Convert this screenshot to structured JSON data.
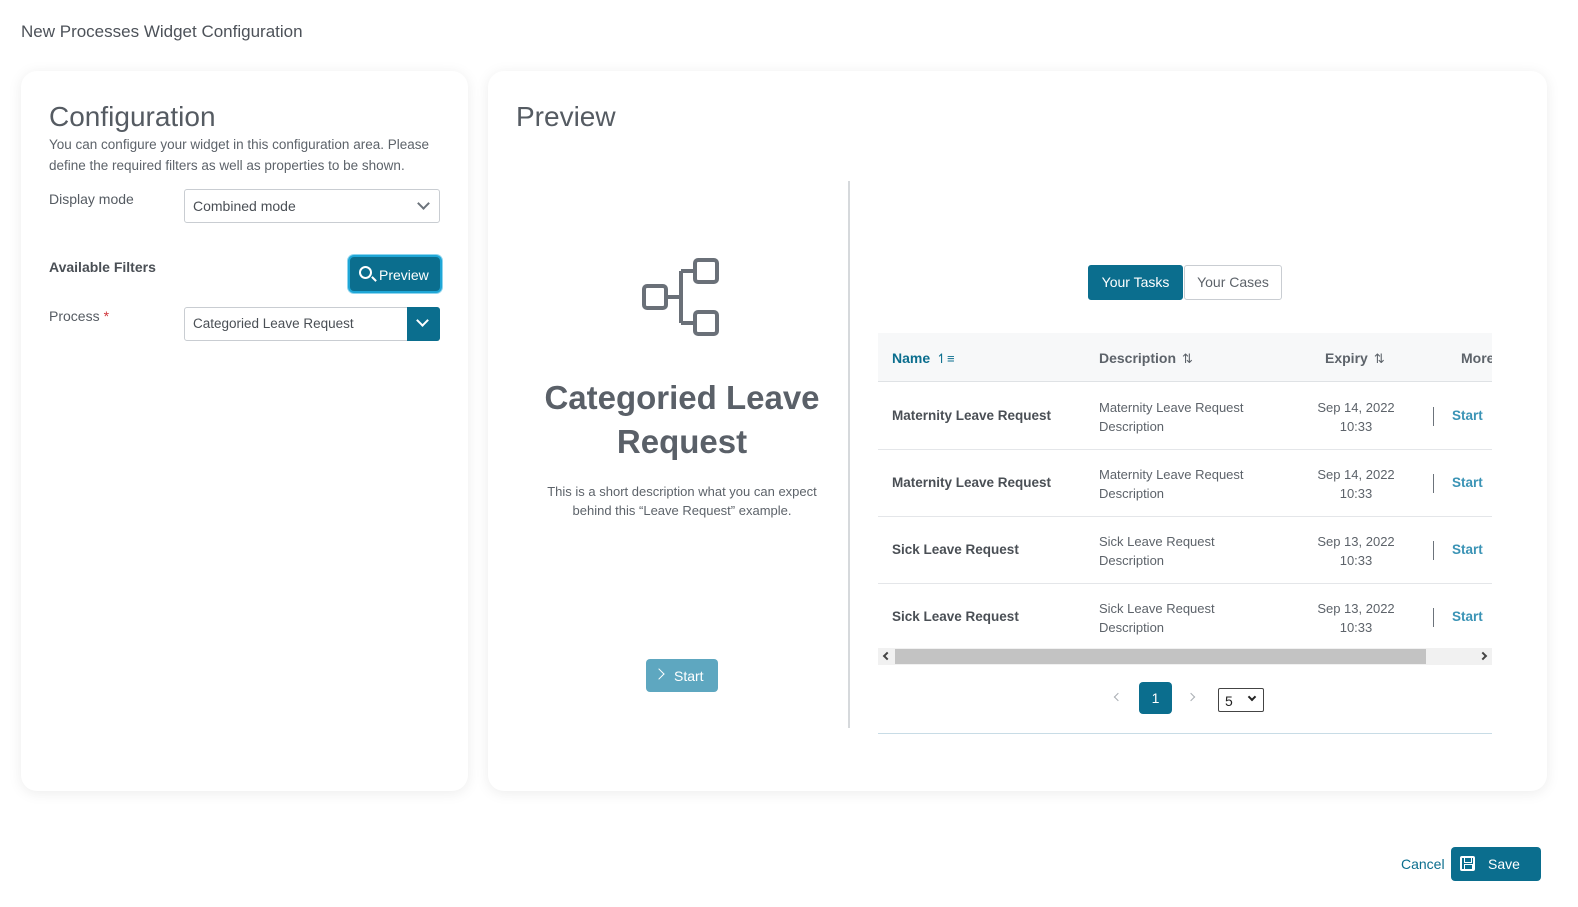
{
  "dialog": {
    "title": "New Processes Widget Configuration",
    "cancel_label": "Cancel",
    "save_label": "Save"
  },
  "configuration": {
    "heading": "Configuration",
    "description": "You can configure your widget in this configuration area. Please define the required filters as well as properties to be shown.",
    "display_mode_label": "Display mode",
    "display_mode_value": "Combined mode",
    "filters_title": "Available Filters",
    "preview_button": "Preview",
    "process_label": "Process",
    "process_required": "*",
    "process_value": "Categoried Leave Request"
  },
  "preview": {
    "heading": "Preview",
    "process_title": "Categoried Leave Request",
    "process_description": "This is a short description what you can expect behind this “Leave Request” example.",
    "start_label": "Start",
    "tabs": [
      {
        "label": "Your Tasks",
        "active": true
      },
      {
        "label": "Your Cases",
        "active": false
      }
    ],
    "columns": [
      "Name",
      "Description",
      "Expiry",
      "More"
    ],
    "rows": [
      {
        "name": "Maternity Leave Request",
        "description": "Maternity Leave Request Description",
        "expiry_date": "Sep 14, 2022",
        "expiry_time": "10:33",
        "action": "Start"
      },
      {
        "name": "Maternity Leave Request",
        "description": "Maternity Leave Request Description",
        "expiry_date": "Sep 14, 2022",
        "expiry_time": "10:33",
        "action": "Start"
      },
      {
        "name": "Sick Leave Request",
        "description": "Sick Leave Request Description",
        "expiry_date": "Sep 13, 2022",
        "expiry_time": "10:33",
        "action": "Start"
      },
      {
        "name": "Sick Leave Request",
        "description": "Sick Leave Request Description",
        "expiry_date": "Sep 13, 2022",
        "expiry_time": "10:33",
        "action": "Start"
      }
    ],
    "pagination": {
      "current_page": "1",
      "page_size": "5"
    }
  },
  "colors": {
    "primary": "#0b6e8e",
    "link": "#3a93b5",
    "required": "#d0343a"
  },
  "icons": [
    "search-icon",
    "chevron-down-icon",
    "process-flow-icon",
    "chevron-right-icon",
    "sort-icon",
    "save-icon"
  ]
}
